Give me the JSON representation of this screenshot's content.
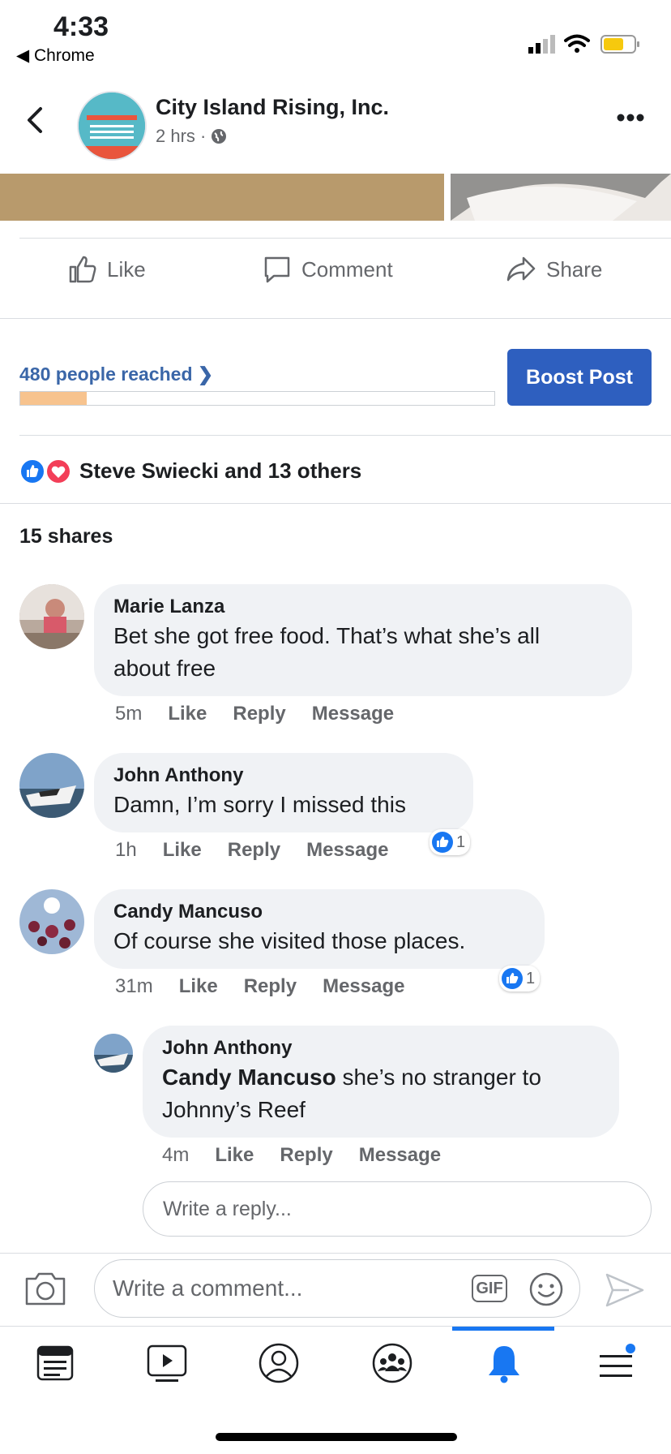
{
  "status_bar": {
    "time": "4:33",
    "back_app": "◀ Chrome"
  },
  "header": {
    "page_name": "City Island Rising, Inc.",
    "post_time": "2 hrs ·"
  },
  "actions": {
    "like": "Like",
    "comment": "Comment",
    "share": "Share"
  },
  "reach": {
    "text": "480 people reached ❯",
    "progress_percent": 14,
    "boost_label": "Boost Post"
  },
  "reactions": {
    "text": "Steve Swiecki and 13 others"
  },
  "shares": "15 shares",
  "comments": [
    {
      "name": "Marie Lanza",
      "lines": [
        "Bet she got free food. That’s what she’s all",
        "about free"
      ],
      "time": "5m",
      "like": "Like",
      "reply": "Reply",
      "message": "Message"
    },
    {
      "name": "John Anthony",
      "lines": [
        "Damn, I’m sorry I missed this"
      ],
      "time": "1h",
      "like": "Like",
      "reply": "Reply",
      "message": "Message",
      "likes_count": "1"
    },
    {
      "name": "Candy Mancuso",
      "lines": [
        "Of course she visited those places."
      ],
      "time": "31m",
      "like": "Like",
      "reply": "Reply",
      "message": "Message",
      "likes_count": "1"
    }
  ],
  "reply": {
    "name": "John Anthony",
    "mention": "Candy Mancuso",
    "text1": " she’s no stranger to",
    "text2": "Johnny’s Reef",
    "time": "4m",
    "like": "Like",
    "reply": "Reply",
    "message": "Message"
  },
  "inputs": {
    "reply_placeholder": "Write a reply...",
    "comment_placeholder": "Write a comment...",
    "gif_label": "GIF"
  },
  "colors": {
    "accent": "#2e5fbf",
    "like_blue": "#1877f2",
    "love_red": "#f33e58",
    "progress": "#f7c38e"
  }
}
